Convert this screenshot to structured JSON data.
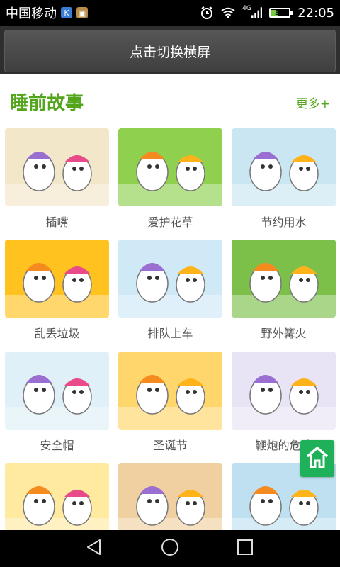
{
  "status_bar": {
    "carrier": "中国移动",
    "app_icons": [
      "k-app-icon",
      "gallery-app-icon"
    ],
    "network_type": "4G",
    "battery_level": 39,
    "battery_text": "39",
    "time": "22:05"
  },
  "orientation_button": {
    "label": "点击切换横屏"
  },
  "section": {
    "title": "睡前故事",
    "more_label": "更多+"
  },
  "stories": [
    {
      "title": "插嘴",
      "thumb_bg": "#f3e7c9"
    },
    {
      "title": "爱护花草",
      "thumb_bg": "#8fd14f"
    },
    {
      "title": "节约用水",
      "thumb_bg": "#c9e6f2"
    },
    {
      "title": "乱丢垃圾",
      "thumb_bg": "#ffc21f"
    },
    {
      "title": "排队上车",
      "thumb_bg": "#cfe9f7"
    },
    {
      "title": "野外篝火",
      "thumb_bg": "#7cc04a"
    },
    {
      "title": "安全帽",
      "thumb_bg": "#dff0f8"
    },
    {
      "title": "圣诞节",
      "thumb_bg": "#ffd66b"
    },
    {
      "title": "鞭炮的危险",
      "thumb_bg": "#e9e4f5"
    },
    {
      "title": "",
      "thumb_bg": "#ffeaa0"
    },
    {
      "title": "",
      "thumb_bg": "#f0d0a0"
    },
    {
      "title": "",
      "thumb_bg": "#bfe0f0"
    }
  ],
  "colors": {
    "accent": "#53a51b",
    "home_button": "#1fb05a"
  },
  "nav": {
    "icons": [
      "back-icon",
      "home-circle-icon",
      "recents-icon"
    ]
  }
}
